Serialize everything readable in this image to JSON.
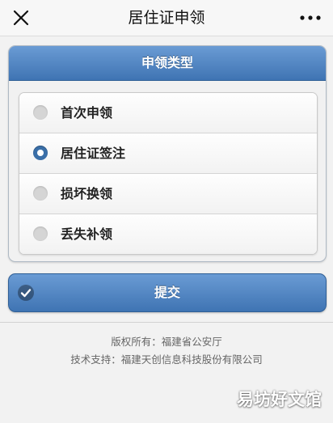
{
  "nav": {
    "title": "居住证申领",
    "close_icon": "close-icon",
    "more_icon": "more-icon"
  },
  "panel": {
    "header": "申领类型",
    "options": [
      {
        "label": "首次申领",
        "checked": false
      },
      {
        "label": "居住证签注",
        "checked": true
      },
      {
        "label": "损坏换领",
        "checked": false
      },
      {
        "label": "丢失补领",
        "checked": false
      }
    ]
  },
  "submit": {
    "label": "提交",
    "icon": "check-icon"
  },
  "footer": {
    "copyright": "版权所有：福建省公安厅",
    "support": "技术支持：福建天创信息科技股份有限公司"
  },
  "watermark": "易坊好文馆",
  "colors": {
    "accent": "#4a7fbf",
    "accent_dark": "#2f5f96",
    "background": "#f2f2f2"
  }
}
